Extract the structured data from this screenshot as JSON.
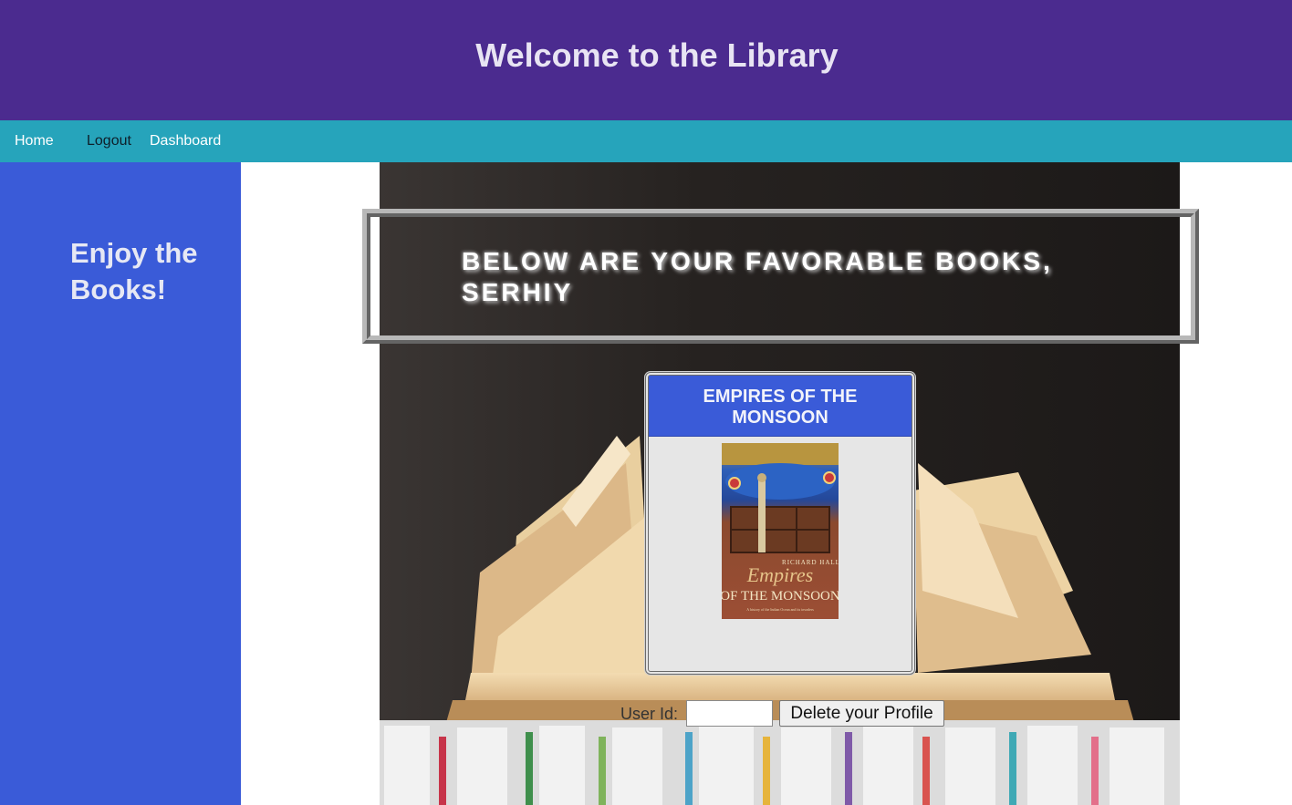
{
  "header": {
    "title": "Welcome to the Library"
  },
  "nav": {
    "items": [
      "Home",
      "Logout",
      "Dashboard"
    ]
  },
  "sidebar": {
    "heading": "Enjoy the Books!"
  },
  "banner": {
    "text": "Below are your favorable books, Serhiy"
  },
  "books": [
    {
      "title": "EMPIRES OF THE MONSOON",
      "cover": {
        "author": "RICHARD HALL",
        "title_line1": "Empires",
        "title_line2": "OF THE MONSOON",
        "subtitle": "A history of the Indian Ocean and its invaders"
      }
    }
  ],
  "delete_form": {
    "label": "User Id:",
    "input_value": "",
    "button_label": "Delete your Profile"
  },
  "colors": {
    "header_bg": "#4b2b8f",
    "nav_bg": "#26a4bb",
    "sidebar_bg": "#3a5bd8",
    "card_header_bg": "#3a5bd8",
    "card_bg": "#e6e6e6"
  }
}
